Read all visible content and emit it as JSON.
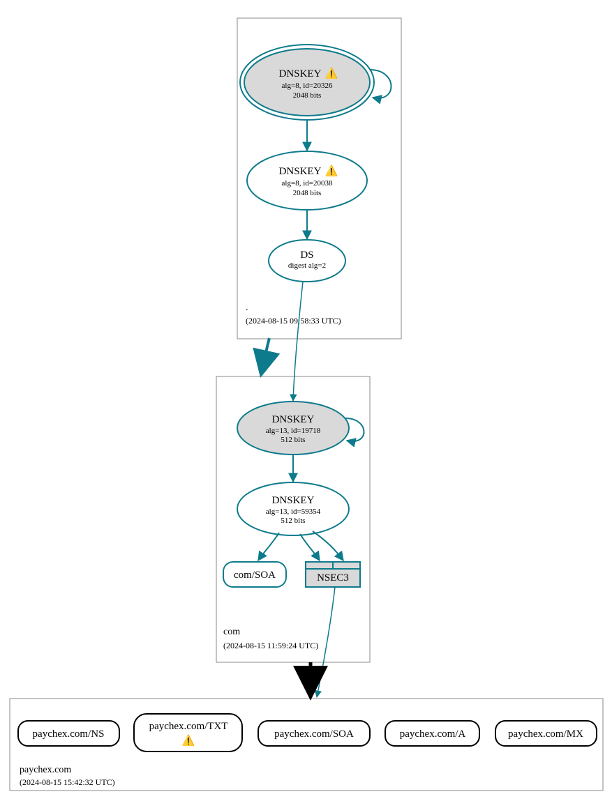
{
  "colors": {
    "teal": "#0e7b8c",
    "gray_fill": "#d9d9d9",
    "black": "#000000",
    "gray_border": "#888888"
  },
  "zones": {
    "root": {
      "label": ".",
      "timestamp": "(2024-08-15 09:58:33 UTC)",
      "nodes": {
        "ksk": {
          "title": "DNSKEY",
          "warn": "⚠️",
          "line2": "alg=8, id=20326",
          "line3": "2048 bits"
        },
        "zsk": {
          "title": "DNSKEY",
          "warn": "⚠️",
          "line2": "alg=8, id=20038",
          "line3": "2048 bits"
        },
        "ds": {
          "title": "DS",
          "line2": "digest alg=2"
        }
      }
    },
    "com": {
      "label": "com",
      "timestamp": "(2024-08-15 11:59:24 UTC)",
      "nodes": {
        "ksk": {
          "title": "DNSKEY",
          "line2": "alg=13, id=19718",
          "line3": "512 bits"
        },
        "zsk": {
          "title": "DNSKEY",
          "line2": "alg=13, id=59354",
          "line3": "512 bits"
        },
        "soa": {
          "title": "com/SOA"
        },
        "nsec3": {
          "title": "NSEC3"
        }
      }
    },
    "leaf": {
      "label": "paychex.com",
      "timestamp": "(2024-08-15 15:42:32 UTC)",
      "nodes": {
        "ns": {
          "title": "paychex.com/NS"
        },
        "txt": {
          "title": "paychex.com/TXT",
          "warn": "⚠️"
        },
        "soa": {
          "title": "paychex.com/SOA"
        },
        "a": {
          "title": "paychex.com/A"
        },
        "mx": {
          "title": "paychex.com/MX"
        }
      }
    }
  }
}
